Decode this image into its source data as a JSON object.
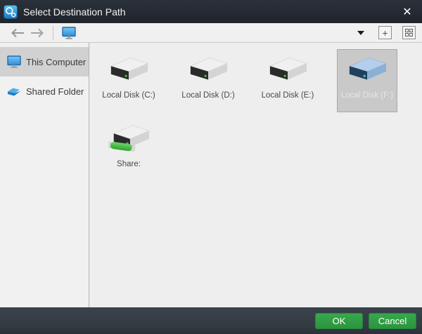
{
  "window": {
    "title": "Select Destination Path"
  },
  "titlebar": {
    "app_icon": "easeus-logo-icon",
    "close_glyph": "✕"
  },
  "toolbar": {
    "back_icon": "arrow-left",
    "forward_icon": "arrow-right",
    "computer_icon": "computer-monitor",
    "dropdown_icon": "caret-down",
    "add_glyph": "+",
    "grid_icon": "view-grid"
  },
  "sidebar": {
    "items": [
      {
        "label": "This Computer",
        "icon": "computer-monitor",
        "selected": true
      },
      {
        "label": "Shared Folder",
        "icon": "shared-folder",
        "selected": false
      }
    ]
  },
  "main": {
    "items": [
      {
        "label": "Local Disk (C:)",
        "icon": "hard-drive",
        "selected": false
      },
      {
        "label": "Local Disk (D:)",
        "icon": "hard-drive",
        "selected": false
      },
      {
        "label": "Local Disk (E:)",
        "icon": "hard-drive",
        "selected": false
      },
      {
        "label": "Local Disk (F:)",
        "icon": "hard-drive-blue",
        "selected": true
      },
      {
        "label": "Share:",
        "icon": "hard-drive-network",
        "selected": false
      }
    ]
  },
  "footer": {
    "ok_label": "OK",
    "cancel_label": "Cancel"
  },
  "colors": {
    "titlebar_bg": "#252b33",
    "footer_bg": "#343c44",
    "accent_green": "#2f9e43",
    "selection_gray": "#c9c9c9",
    "toolbar_bg": "#f0f0f0"
  }
}
